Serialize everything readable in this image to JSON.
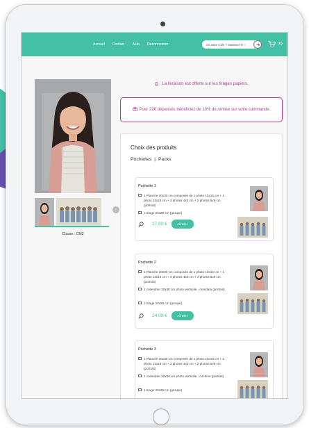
{
  "nav": {
    "links": [
      "Accueil",
      "Contact",
      "Aide",
      "Déconnexion"
    ],
    "search_placeholder": "Un autre code ? Saisissez-le !",
    "cart_count": "(0)"
  },
  "left": {
    "class_label": "Classe : CM2"
  },
  "banner": {
    "delivery_text": "La livraison est offerte sur les tirages papiers.",
    "promo_text": "Pour 22€ dépensés bénéficiez de 10% de remise sur votre commande."
  },
  "products": {
    "title": "Choix des produits",
    "tab_pochettes": "Pochettes",
    "tab_sep": "|",
    "tab_packs": "Packs",
    "buy_label": "Acheter",
    "items": [
      {
        "name": "Pochette 1",
        "lines": [
          "1 Planche 20x30 cm composée de 1 photo 10x15 cm + 1 photo 13x18 cm + 3 photos 4x3 cm + 2 photos 6x9 cm (portrait)",
          "1 tirage 20x30 cm (groupe)"
        ],
        "price": "17,00 €"
      },
      {
        "name": "Pochette 2",
        "lines": [
          "1 Planche 20x30 cm composée de 1 photo 10x15 cm + 1 photo 13x18 cm + 3 photos 4x3 cm + 2 photos 6x9 cm (portrait)",
          "1 calendrier 20x30 cm photo verticale - mandala (portrait)",
          "1 tirage 20x30 cm (groupe)"
        ],
        "price": "24,00 €"
      },
      {
        "name": "Pochette 3",
        "lines": [
          "1 Planche 20x30 cm composée de 1 photo 10x15 cm + 1 photo 13x18 cm + 3 photos 4x3 cm + 2 photos 6x9 cm (portrait)",
          "1 calendrier 20x30 cm photo verticale - col-time (portrait)",
          "1 tirage 20x30 cm (groupe)"
        ],
        "price": ""
      }
    ]
  },
  "colors": {
    "accent": "#44c0a4",
    "promo": "#b0389a"
  }
}
